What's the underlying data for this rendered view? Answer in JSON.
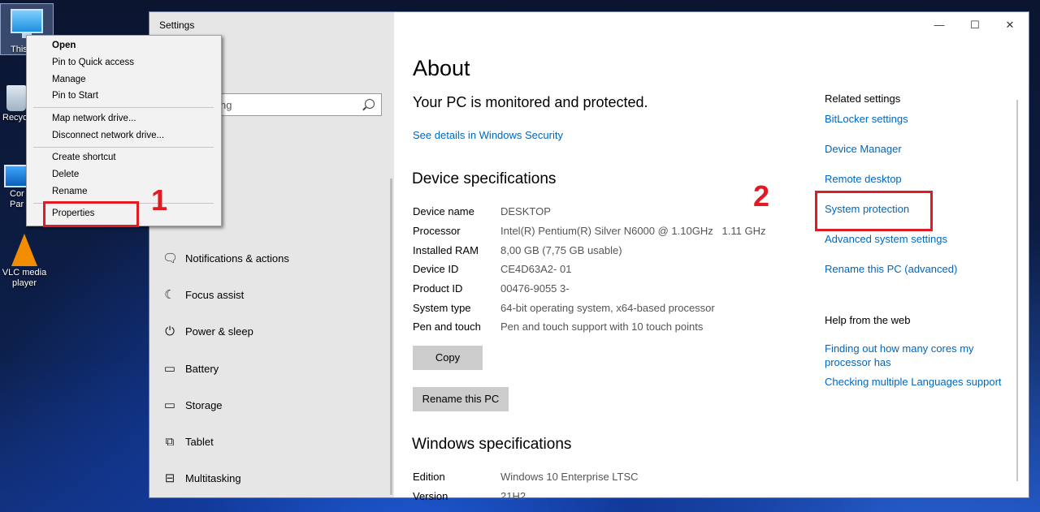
{
  "desktop": {
    "icons": [
      {
        "label": "This"
      },
      {
        "label": "Recyc"
      },
      {
        "label": "Cor\nPar"
      },
      {
        "label": "VLC media player"
      }
    ]
  },
  "window": {
    "title": "Settings",
    "search_placeholder_visible": "ng",
    "controls": {
      "minimize": "—",
      "maximize": "☐",
      "close": "✕"
    }
  },
  "sidebar": {
    "items": [
      {
        "label": "Notifications & actions",
        "icon": "notification-icon"
      },
      {
        "label": "Focus assist",
        "icon": "moon-icon"
      },
      {
        "label": "Power & sleep",
        "icon": "power-icon"
      },
      {
        "label": "Battery",
        "icon": "battery-icon"
      },
      {
        "label": "Storage",
        "icon": "storage-icon"
      },
      {
        "label": "Tablet",
        "icon": "tablet-icon"
      },
      {
        "label": "Multitasking",
        "icon": "multitasking-icon"
      }
    ]
  },
  "about": {
    "title": "About",
    "status": "Your PC is monitored and protected.",
    "security_link": "See details in Windows Security",
    "device_heading": "Device specifications",
    "specs": [
      {
        "label": "Device name",
        "value": "DESKTOP"
      },
      {
        "label": "Processor",
        "value": "Intel(R) Pentium(R) Silver N6000 @ 1.10GHz   1.11 GHz"
      },
      {
        "label": "Installed RAM",
        "value": "8,00 GB (7,75 GB usable)"
      },
      {
        "label": "Device ID",
        "value": "CE4D63A2- 01"
      },
      {
        "label": "Product ID",
        "value": "00476-9055 3-"
      },
      {
        "label": "System type",
        "value": "64-bit operating system, x64-based processor"
      },
      {
        "label": "Pen and touch",
        "value": "Pen and touch support with 10 touch points"
      }
    ],
    "copy_button": "Copy",
    "rename_button": "Rename this PC",
    "windows_heading": "Windows specifications",
    "win_specs": [
      {
        "label": "Edition",
        "value": "Windows 10 Enterprise LTSC"
      },
      {
        "label": "Version",
        "value": "21H2"
      }
    ]
  },
  "related": {
    "heading": "Related settings",
    "links": [
      "BitLocker settings",
      "Device Manager",
      "Remote desktop",
      "System protection",
      "Advanced system settings",
      "Rename this PC (advanced)"
    ],
    "help_heading": "Help from the web",
    "help_links": [
      "Finding out how many cores my processor has",
      "Checking multiple Languages support"
    ]
  },
  "context_menu": {
    "items": [
      "Open",
      "Pin to Quick access",
      "Manage",
      "Pin to Start",
      "Map network drive...",
      "Disconnect network drive...",
      "Create shortcut",
      "Delete",
      "Rename",
      "Properties"
    ]
  },
  "annotations": {
    "step1": "1",
    "step2": "2",
    "color": "#e01b24"
  }
}
